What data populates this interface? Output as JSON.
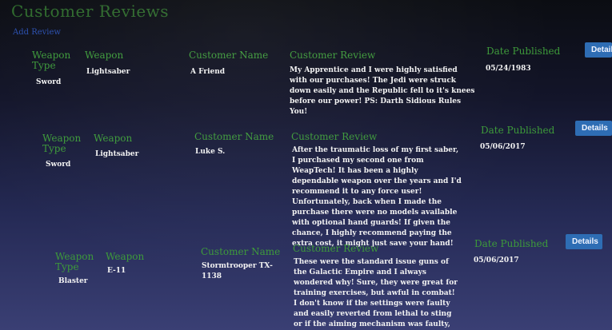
{
  "page": {
    "title": "Customer Reviews",
    "add_review_label": "Add Review"
  },
  "reviews": [
    {
      "weapon_type_header": "Weapon Type",
      "weapon_header": "Weapon",
      "customer_name_header": "Customer Name",
      "customer_review_header": "Customer Review",
      "date_header": "Date Published",
      "weapon_type": "Sword",
      "weapon": "Lightsaber",
      "customer_name": "A Friend",
      "review": "My Apprentice and I were highly satisfied with our purchases! The Jedi were struck down easily and the Republic fell to it's knees before our power! PS: Darth Sidious Rules You!",
      "date": "05/24/1983",
      "details_label": "Details"
    },
    {
      "weapon_type_header": "Weapon Type",
      "weapon_header": "Weapon",
      "customer_name_header": "Customer Name",
      "customer_review_header": "Customer Review",
      "date_header": "Date Published",
      "weapon_type": "Sword",
      "weapon": "Lightsaber",
      "customer_name": "Luke S.",
      "review": "After the traumatic loss of my first saber, I purchased my second one from WeapTech! It has been a highly dependable weapon over the years and I'd recommend it to any force user! Unfortunately, back when I made the purchase there were no models available with optional hand guards! If given the chance, I highly recommend paying the extra cost, it might just save your hand!",
      "date": "05/06/2017",
      "details_label": "Details"
    },
    {
      "weapon_type_header": "Weapon Type",
      "weapon_header": "Weapon",
      "customer_name_header": "Customer Name",
      "customer_review_header": "Customer Review",
      "date_header": "Date Published",
      "weapon_type": "Blaster",
      "weapon": "E-11",
      "customer_name": "Stormtrooper TX-1138",
      "review": "These were the standard issue guns of the Galactic Empire and I always wondered why! Sure, they were great for training exercises, but awful in combat! I don't know if the settings were faulty and easily reverted from lethal to sting or if the aiming mechanism was faulty, but it always felt like I was",
      "date": "05/06/2017",
      "details_label": "Details"
    }
  ]
}
